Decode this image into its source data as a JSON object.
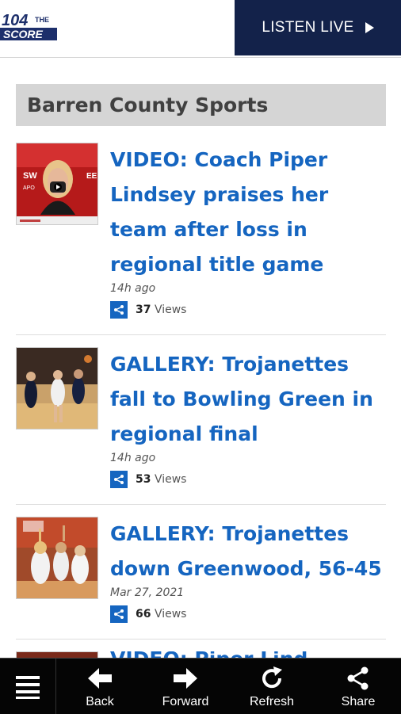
{
  "header": {
    "logo_text": "104.1 THE SCORE",
    "logo_big": "104",
    "logo_small": "THE",
    "logo_score": "SCORE",
    "listen_label": "LISTEN LIVE"
  },
  "section": {
    "title": "Barren County Sports"
  },
  "articles": [
    {
      "title": "VIDEO: Coach Piper Lindsey praises her team after loss in regional title game",
      "time": "14h ago",
      "views_count": "37",
      "views_label": "Views"
    },
    {
      "title": "GALLERY: Trojanettes fall to Bowling Green in regional final",
      "time": "14h ago",
      "views_count": "53",
      "views_label": "Views"
    },
    {
      "title": "GALLERY: Trojanettes down Greenwood, 56-45",
      "time": "Mar 27, 2021",
      "views_count": "66",
      "views_label": "Views"
    },
    {
      "title": "VIDEO: Piper Lind..."
    }
  ],
  "bottom_nav": {
    "back": "Back",
    "forward": "Forward",
    "refresh": "Refresh",
    "share": "Share"
  },
  "colors": {
    "link": "#1565c0",
    "header_dark": "#13224a",
    "bottom_bar": "#050505"
  }
}
